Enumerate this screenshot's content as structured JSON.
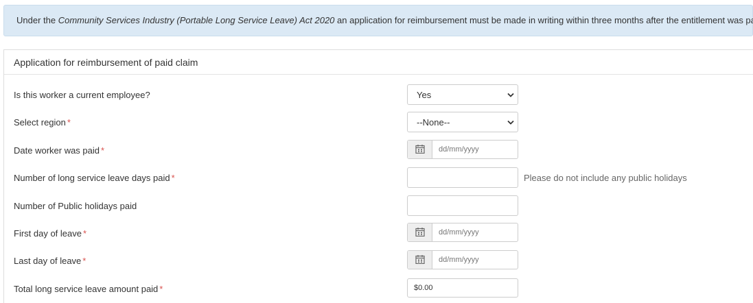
{
  "banner": {
    "prefix": "Under the ",
    "act": "Community Services Industry (Portable Long Service Leave) Act 2020",
    "suffix": " an application for reimbursement must be made in writing within three months after the entitlement was paid."
  },
  "panel": {
    "title": "Application for reimbursement of paid claim"
  },
  "fields": {
    "current_employee": {
      "label": "Is this worker a current employee?",
      "value": "Yes"
    },
    "region": {
      "label": "Select region",
      "value": "--None--",
      "required": "*"
    },
    "date_paid": {
      "label": "Date worker was paid",
      "placeholder": "dd/mm/yyyy",
      "required": "*",
      "icon": "calendar-icon"
    },
    "lsl_days": {
      "label": "Number of long service leave days paid",
      "required": "*",
      "value": "",
      "help": "Please do not include any public holidays"
    },
    "public_holidays": {
      "label": "Number of Public holidays paid",
      "value": ""
    },
    "first_day": {
      "label": "First day of leave",
      "placeholder": "dd/mm/yyyy",
      "required": "*",
      "icon": "calendar-icon"
    },
    "last_day": {
      "label": "Last day of leave",
      "placeholder": "dd/mm/yyyy",
      "required": "*",
      "icon": "calendar-icon"
    },
    "total_amount": {
      "label": "Total long service leave amount paid",
      "required": "*",
      "value": "$0.00"
    }
  },
  "colors": {
    "banner_bg": "#dbe9f5",
    "required": "#d9534f",
    "addon_bg": "#eeeeee",
    "border": "#cccccc"
  }
}
